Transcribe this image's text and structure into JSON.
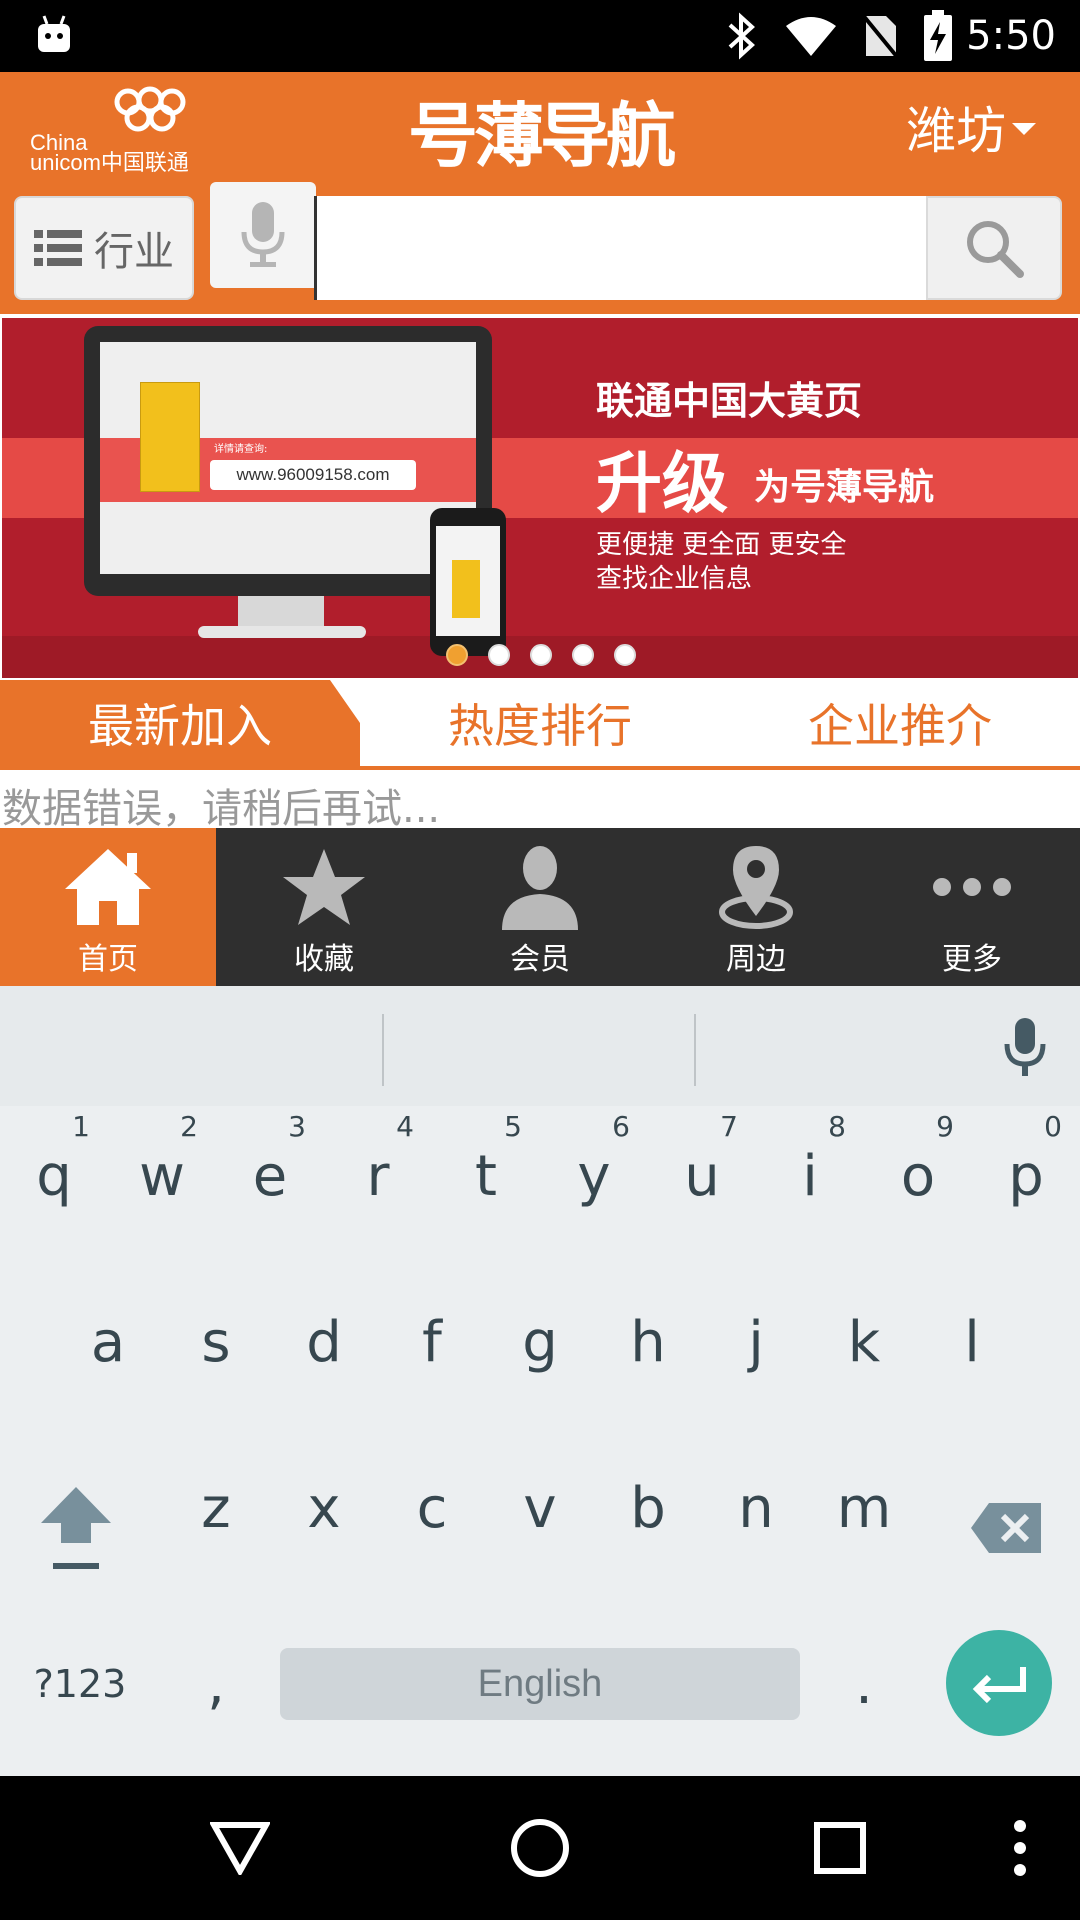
{
  "status_bar": {
    "time": "5:50"
  },
  "header": {
    "logo_line1": "China",
    "logo_line2": "unicom中国联通",
    "app_title": "号薄导航",
    "city": "潍坊",
    "industry_label": "行业",
    "search": {
      "value": "",
      "placeholder": ""
    }
  },
  "banner": {
    "url": "www.96009158.com",
    "url_hint": "详情请查询:",
    "line1": "联通中国大黄页",
    "line2": "升级",
    "line2b": "为号薄导航",
    "line3": "更便捷  更全面  更安全",
    "line4": "查找企业信息",
    "slide_count": 5,
    "active_slide": 0
  },
  "tabs": [
    {
      "label": "最新加入",
      "active": true
    },
    {
      "label": "热度排行",
      "active": false
    },
    {
      "label": "企业推介",
      "active": false
    }
  ],
  "error_message": "数据错误，请稍后再试...",
  "bottom_nav": [
    {
      "label": "首页",
      "icon": "home-icon",
      "active": true
    },
    {
      "label": "收藏",
      "icon": "star-icon",
      "active": false
    },
    {
      "label": "会员",
      "icon": "person-icon",
      "active": false
    },
    {
      "label": "周边",
      "icon": "location-pin-icon",
      "active": false
    },
    {
      "label": "更多",
      "icon": "more-dots-icon",
      "active": false
    }
  ],
  "keyboard": {
    "row1": [
      "q",
      "w",
      "e",
      "r",
      "t",
      "y",
      "u",
      "i",
      "o",
      "p"
    ],
    "row1_nums": [
      "1",
      "2",
      "3",
      "4",
      "5",
      "6",
      "7",
      "8",
      "9",
      "0"
    ],
    "row2": [
      "a",
      "s",
      "d",
      "f",
      "g",
      "h",
      "j",
      "k",
      "l"
    ],
    "row3": [
      "z",
      "x",
      "c",
      "v",
      "b",
      "n",
      "m"
    ],
    "symbols_label": "?123",
    "comma": ",",
    "space_label": "English",
    "period": "."
  },
  "colors": {
    "accent": "#e8732a",
    "nav_bg": "#2f2f2f",
    "enter": "#3db3a4"
  }
}
